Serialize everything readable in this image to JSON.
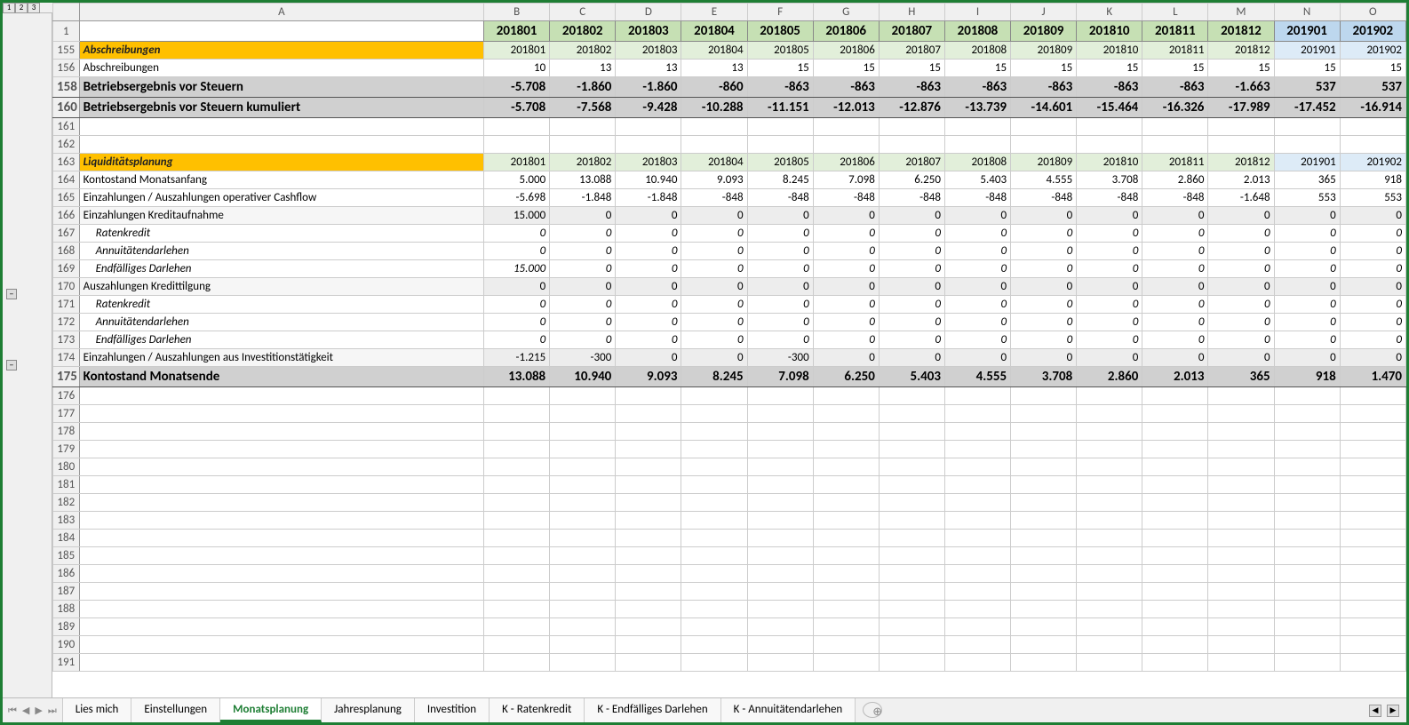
{
  "outline_buttons": [
    "1",
    "2",
    "3"
  ],
  "columns": [
    "A",
    "B",
    "C",
    "D",
    "E",
    "F",
    "G",
    "H",
    "I",
    "J",
    "K",
    "L",
    "M",
    "N",
    "O"
  ],
  "frozen_row_number": "1",
  "periods": [
    "201801",
    "201802",
    "201803",
    "201804",
    "201805",
    "201806",
    "201807",
    "201808",
    "201809",
    "201810",
    "201811",
    "201812",
    "201901",
    "201902"
  ],
  "period_green_count": 12,
  "rows": [
    {
      "n": "155",
      "label": "Abschreibungen",
      "style": "sect-hdr",
      "vals": [
        "201801",
        "201802",
        "201803",
        "201804",
        "201805",
        "201806",
        "201807",
        "201808",
        "201809",
        "201810",
        "201811",
        "201812",
        "201901",
        "201902"
      ],
      "subperiod": true
    },
    {
      "n": "156",
      "label": "Abschreibungen",
      "style": "normal",
      "vals": [
        "10",
        "13",
        "13",
        "13",
        "15",
        "15",
        "15",
        "15",
        "15",
        "15",
        "15",
        "15",
        "15",
        "15"
      ]
    },
    {
      "n": "158",
      "label": "Betriebsergebnis vor Steuern",
      "style": "boldrow",
      "vals": [
        "-5.708",
        "-1.860",
        "-1.860",
        "-860",
        "-863",
        "-863",
        "-863",
        "-863",
        "-863",
        "-863",
        "-863",
        "-1.663",
        "537",
        "537"
      ]
    },
    {
      "n": "160",
      "label": "Betriebsergebnis vor Steuern kumuliert",
      "style": "boldrow",
      "vals": [
        "-5.708",
        "-7.568",
        "-9.428",
        "-10.288",
        "-11.151",
        "-12.013",
        "-12.876",
        "-13.739",
        "-14.601",
        "-15.464",
        "-16.326",
        "-17.989",
        "-17.452",
        "-16.914"
      ]
    },
    {
      "n": "161",
      "label": "",
      "style": "empty",
      "vals": [
        "",
        "",
        "",
        "",
        "",
        "",
        "",
        "",
        "",
        "",
        "",
        "",
        "",
        ""
      ]
    },
    {
      "n": "162",
      "label": "",
      "style": "empty",
      "vals": [
        "",
        "",
        "",
        "",
        "",
        "",
        "",
        "",
        "",
        "",
        "",
        "",
        "",
        ""
      ]
    },
    {
      "n": "163",
      "label": "Liquiditätsplanung",
      "style": "sect-hdr",
      "vals": [
        "201801",
        "201802",
        "201803",
        "201804",
        "201805",
        "201806",
        "201807",
        "201808",
        "201809",
        "201810",
        "201811",
        "201812",
        "201901",
        "201902"
      ],
      "subperiod": true
    },
    {
      "n": "164",
      "label": "Kontostand Monatsanfang",
      "style": "normal",
      "vals": [
        "5.000",
        "13.088",
        "10.940",
        "9.093",
        "8.245",
        "7.098",
        "6.250",
        "5.403",
        "4.555",
        "3.708",
        "2.860",
        "2.013",
        "365",
        "918"
      ]
    },
    {
      "n": "165",
      "label": "Einzahlungen / Auszahlungen operativer Cashflow",
      "style": "normal",
      "vals": [
        "-5.698",
        "-1.848",
        "-1.848",
        "-848",
        "-848",
        "-848",
        "-848",
        "-848",
        "-848",
        "-848",
        "-848",
        "-1.648",
        "553",
        "553"
      ]
    },
    {
      "n": "166",
      "label": "Einzahlungen Kreditaufnahme",
      "style": "shaded",
      "vals": [
        "15.000",
        "0",
        "0",
        "0",
        "0",
        "0",
        "0",
        "0",
        "0",
        "0",
        "0",
        "0",
        "0",
        "0"
      ]
    },
    {
      "n": "167",
      "label": "Ratenkredit",
      "style": "italic indent",
      "vals": [
        "0",
        "0",
        "0",
        "0",
        "0",
        "0",
        "0",
        "0",
        "0",
        "0",
        "0",
        "0",
        "0",
        "0"
      ],
      "italicvals": true
    },
    {
      "n": "168",
      "label": "Annuitätendarlehen",
      "style": "italic indent",
      "vals": [
        "0",
        "0",
        "0",
        "0",
        "0",
        "0",
        "0",
        "0",
        "0",
        "0",
        "0",
        "0",
        "0",
        "0"
      ],
      "italicvals": true
    },
    {
      "n": "169",
      "label": "Endfälliges Darlehen",
      "style": "italic indent",
      "vals": [
        "15.000",
        "0",
        "0",
        "0",
        "0",
        "0",
        "0",
        "0",
        "0",
        "0",
        "0",
        "0",
        "0",
        "0"
      ],
      "italicvals": true
    },
    {
      "n": "170",
      "label": "Auszahlungen Kredittilgung",
      "style": "shaded",
      "vals": [
        "0",
        "0",
        "0",
        "0",
        "0",
        "0",
        "0",
        "0",
        "0",
        "0",
        "0",
        "0",
        "0",
        "0"
      ]
    },
    {
      "n": "171",
      "label": "Ratenkredit",
      "style": "italic indent",
      "vals": [
        "0",
        "0",
        "0",
        "0",
        "0",
        "0",
        "0",
        "0",
        "0",
        "0",
        "0",
        "0",
        "0",
        "0"
      ],
      "italicvals": true
    },
    {
      "n": "172",
      "label": "Annuitätendarlehen",
      "style": "italic indent",
      "vals": [
        "0",
        "0",
        "0",
        "0",
        "0",
        "0",
        "0",
        "0",
        "0",
        "0",
        "0",
        "0",
        "0",
        "0"
      ],
      "italicvals": true
    },
    {
      "n": "173",
      "label": "Endfälliges Darlehen",
      "style": "italic indent",
      "vals": [
        "0",
        "0",
        "0",
        "0",
        "0",
        "0",
        "0",
        "0",
        "0",
        "0",
        "0",
        "0",
        "0",
        "0"
      ],
      "italicvals": true
    },
    {
      "n": "174",
      "label": "Einzahlungen / Auszahlungen aus Investitionstätigkeit",
      "style": "shaded",
      "vals": [
        "-1.215",
        "-300",
        "0",
        "0",
        "-300",
        "0",
        "0",
        "0",
        "0",
        "0",
        "0",
        "0",
        "0",
        "0"
      ]
    },
    {
      "n": "175",
      "label": "Kontostand Monatsende",
      "style": "boldrow",
      "vals": [
        "13.088",
        "10.940",
        "9.093",
        "8.245",
        "7.098",
        "6.250",
        "5.403",
        "4.555",
        "3.708",
        "2.860",
        "2.013",
        "365",
        "918",
        "1.470"
      ]
    }
  ],
  "empty_rows": [
    "176",
    "177",
    "178",
    "179",
    "180",
    "181",
    "182",
    "183",
    "184",
    "185",
    "186",
    "187",
    "188",
    "189",
    "190",
    "191"
  ],
  "tabs": [
    "Lies mich",
    "Einstellungen",
    "Monatsplanung",
    "Jahresplanung",
    "Investition",
    "K - Ratenkredit",
    "K - Endfälliges Darlehen",
    "K - Annuitätendarlehen"
  ],
  "active_tab_index": 2,
  "tab_add_glyph": "⊕",
  "nav_glyphs": [
    "⏮",
    "◀",
    "▶",
    "⏭"
  ],
  "scroll_arrows": [
    "◀",
    "▶"
  ]
}
